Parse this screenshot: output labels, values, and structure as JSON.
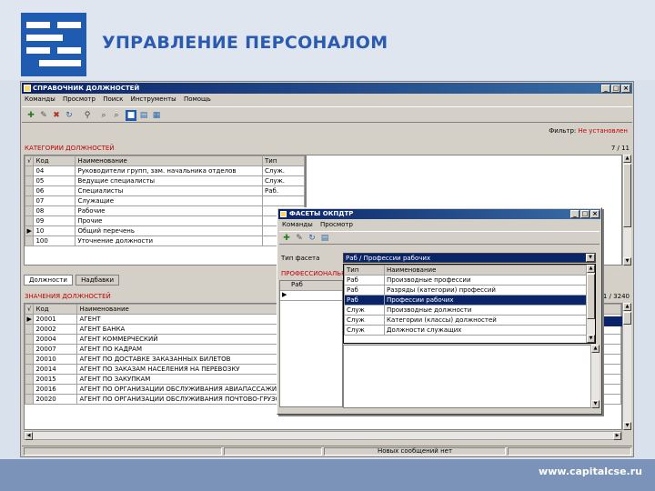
{
  "slide": {
    "title": "УПРАВЛЕНИЕ ПЕРСОНАЛОМ",
    "url": "www.capitalcse.ru",
    "accent": "#2b5bb0"
  },
  "window": {
    "title": "СПРАВОЧНИК ДОЛЖНОСТЕЙ",
    "menu": [
      "Команды",
      "Просмотр",
      "Поиск",
      "Инструменты",
      "Помощь"
    ],
    "filter_label": "Фильтр:",
    "filter_value": "Не установлен",
    "categories_label": "КАТЕГОРИИ ДОЛЖНОСТЕЙ",
    "categories_count": "7 / 11",
    "categories_headers": [
      "Код",
      "Наименование",
      "Тип"
    ],
    "categories": [
      {
        "code": "04",
        "name": "Руководители групп, зам. начальника отделов",
        "type": "Служ."
      },
      {
        "code": "05",
        "name": "Ведущие специалисты",
        "type": "Служ."
      },
      {
        "code": "06",
        "name": "Специалисты",
        "type": "Раб."
      },
      {
        "code": "07",
        "name": "Служащие",
        "type": ""
      },
      {
        "code": "08",
        "name": "Рабочие",
        "type": ""
      },
      {
        "code": "09",
        "name": "Прочие",
        "type": ""
      },
      {
        "code": "10",
        "name": "Общий перечень",
        "type": ""
      },
      {
        "code": "100",
        "name": "Уточнение должности",
        "type": ""
      }
    ],
    "tabs": [
      "Должности",
      "Надбавки"
    ],
    "positions_label": "ЗНАЧЕНИЯ ДОЛЖНОСТЕЙ",
    "positions_count": "1 / 3240",
    "positions_headers": [
      "Код",
      "Наименование"
    ],
    "positions": [
      {
        "code": "20001",
        "name": "АГЕНТ"
      },
      {
        "code": "20002",
        "name": "АГЕНТ БАНКА"
      },
      {
        "code": "20004",
        "name": "АГЕНТ КОММЕРЧЕСКИЙ"
      },
      {
        "code": "20007",
        "name": "АГЕНТ ПО КАДРАМ"
      },
      {
        "code": "20010",
        "name": "АГЕНТ ПО ДОСТАВКЕ ЗАКАЗАННЫХ БИЛЕТОВ"
      },
      {
        "code": "20014",
        "name": "АГЕНТ ПО ЗАКАЗАМ НАСЕЛЕНИЯ НА ПЕРЕВОЗКУ"
      },
      {
        "code": "20015",
        "name": "АГЕНТ ПО ЗАКУПКАМ"
      },
      {
        "code": "20016",
        "name": "АГЕНТ ПО ОРГАНИЗАЦИИ ОБСЛУЖИВАНИЯ АВИАПАССАЖИРОВ"
      },
      {
        "code": "20020",
        "name": "АГЕНТ ПО ОРГАНИЗАЦИИ ОБСЛУЖИВАНИЯ ПОЧТОВО-ГРУЗОВЫХ ПЕРЕВОЗОК"
      }
    ],
    "status_message": "Новых сообщений нет"
  },
  "dialog": {
    "title": "ФАСЕТЫ ОКПДТР",
    "menu": [
      "Команды",
      "Просмотр"
    ],
    "facet_label": "Тип фасета",
    "facet_value": "Раб / Профессии рабочих",
    "sub_label": "ПРОФЕССИОНАЛЬНЫЕ",
    "sub_header": "Раб",
    "dropdown": [
      {
        "type": "Тип",
        "name": "Наименование"
      },
      {
        "type": "Раб",
        "name": "Производные профессии"
      },
      {
        "type": "Раб",
        "name": "Разряды (категории) профессий"
      },
      {
        "type": "Раб",
        "name": "Профессии рабочих"
      },
      {
        "type": "Служ",
        "name": "Производные должности"
      },
      {
        "type": "Служ",
        "name": "Категории (классы) должностей"
      },
      {
        "type": "Служ",
        "name": "Должности служащих"
      }
    ],
    "selected_index": 3
  }
}
